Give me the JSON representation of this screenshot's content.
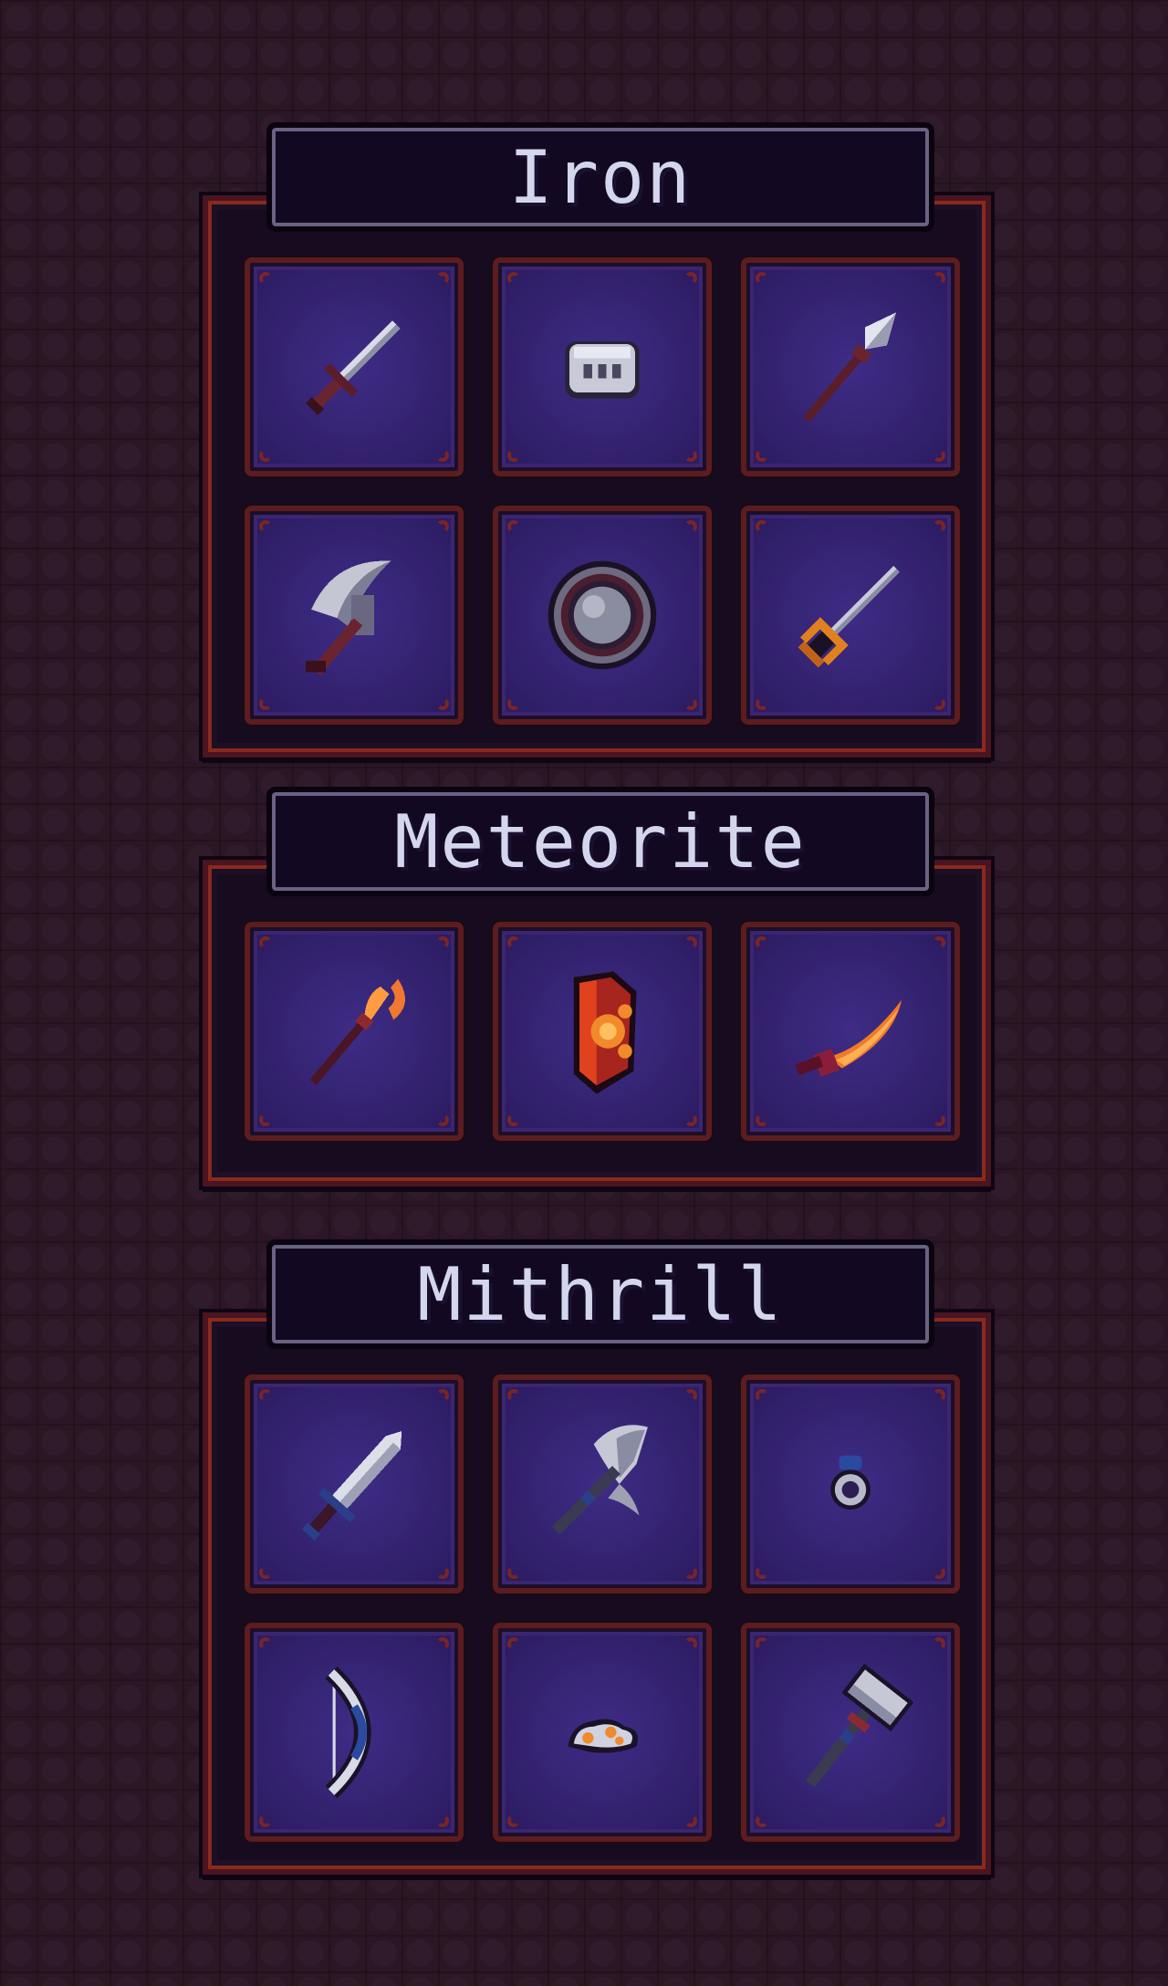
{
  "colors": {
    "background": "#2a1624",
    "panel_frame": "#8a2a1c",
    "slot_fill": "#342270",
    "title_text": "#d4d6ee"
  },
  "panels": [
    {
      "title": "Iron",
      "items": [
        {
          "icon": "dagger-icon"
        },
        {
          "icon": "ingot-icon"
        },
        {
          "icon": "spear-icon"
        },
        {
          "icon": "pickaxe-icon"
        },
        {
          "icon": "round-shield-icon"
        },
        {
          "icon": "trident-icon"
        }
      ]
    },
    {
      "title": "Meteorite",
      "items": [
        {
          "icon": "scythe-spear-icon"
        },
        {
          "icon": "tower-shield-icon"
        },
        {
          "icon": "curved-blade-icon"
        }
      ]
    },
    {
      "title": "Mithrill",
      "items": [
        {
          "icon": "sword-icon"
        },
        {
          "icon": "battle-axe-icon"
        },
        {
          "icon": "ring-icon"
        },
        {
          "icon": "bow-icon"
        },
        {
          "icon": "ore-icon"
        },
        {
          "icon": "hammer-icon"
        }
      ]
    }
  ]
}
